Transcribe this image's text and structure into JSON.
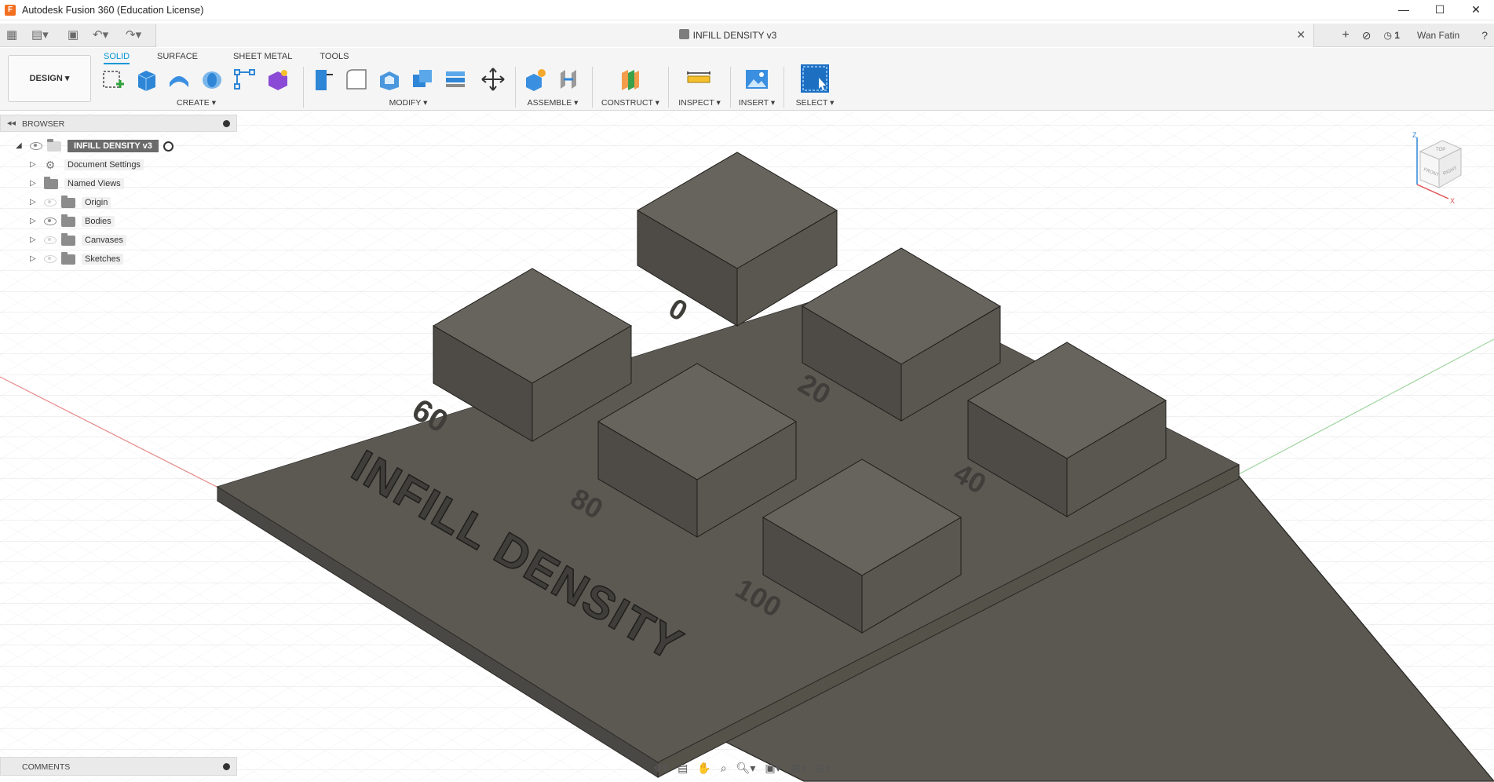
{
  "window": {
    "title": "Autodesk Fusion 360 (Education License)"
  },
  "document": {
    "title": "INFILL DENSITY v3"
  },
  "qat": {
    "user": "Wan Fatin",
    "notifications": "1"
  },
  "workspace": {
    "label": "DESIGN ▾"
  },
  "tabs": [
    "SOLID",
    "SURFACE",
    "SHEET METAL",
    "TOOLS"
  ],
  "groups": {
    "create": "CREATE ▾",
    "modify": "MODIFY ▾",
    "assemble": "ASSEMBLE ▾",
    "construct": "CONSTRUCT ▾",
    "inspect": "INSPECT ▾",
    "insert": "INSERT ▾",
    "select": "SELECT ▾"
  },
  "browser": {
    "label": "BROWSER",
    "root": "INFILL DENSITY v3",
    "items": [
      "Document Settings",
      "Named Views",
      "Origin",
      "Bodies",
      "Canvases",
      "Sketches"
    ]
  },
  "comments": {
    "label": "COMMENTS"
  },
  "model": {
    "title_text": "INFILL DENSITY",
    "labels": [
      "0",
      "20",
      "40",
      "60",
      "80",
      "100"
    ]
  },
  "viewcube": {
    "top": "TOP",
    "front": "FRONT",
    "right": "RIGHT",
    "x": "X",
    "z": "Z"
  },
  "colors": {
    "accent": "#0696d7",
    "model": "#5b5852"
  }
}
